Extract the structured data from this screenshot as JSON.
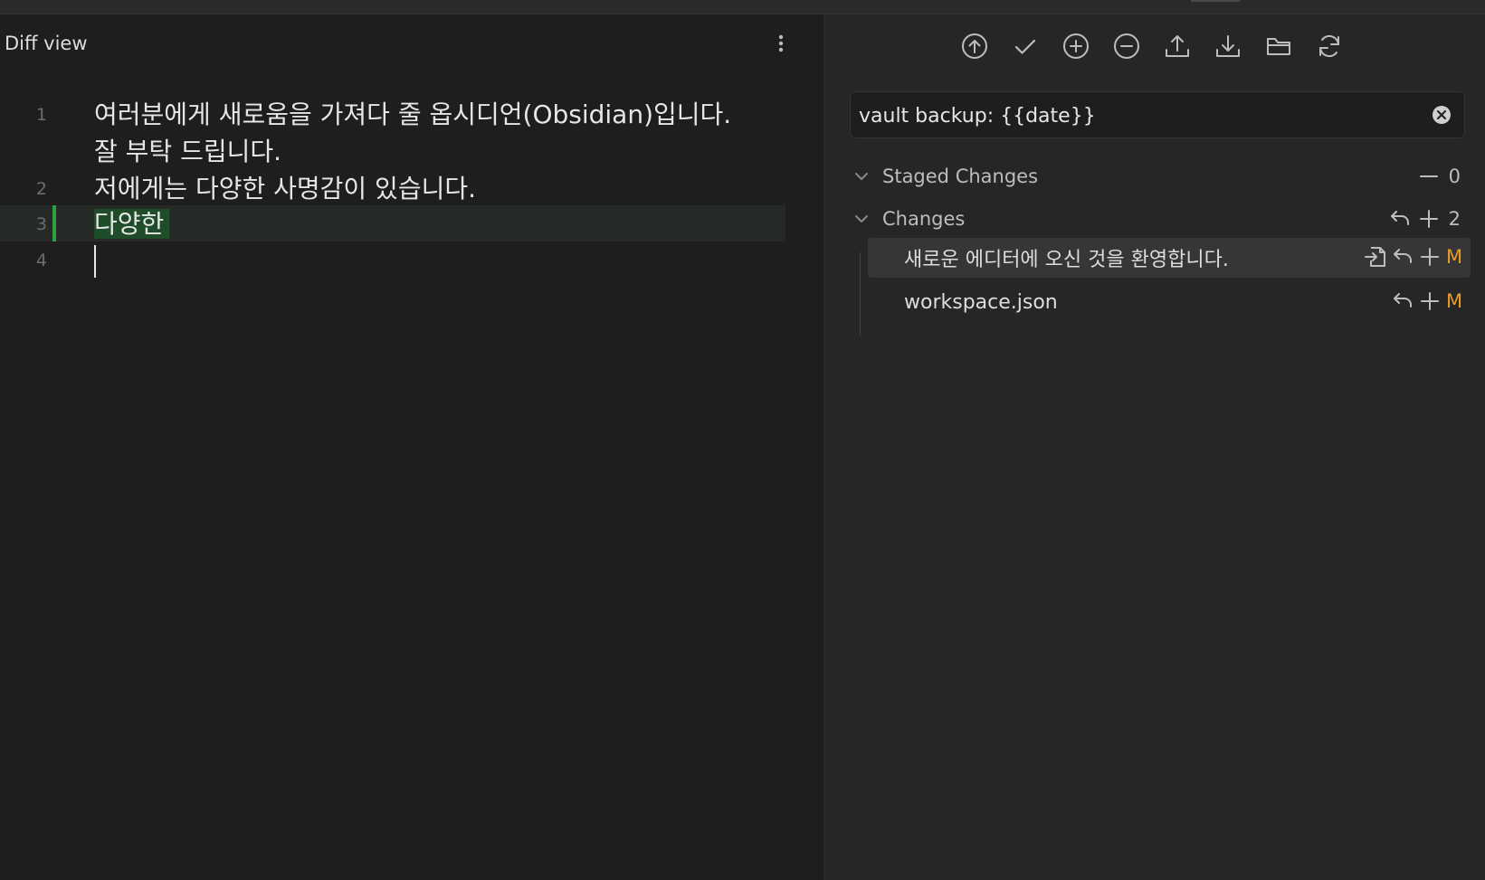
{
  "diff_view": {
    "title": "Diff view",
    "lines": [
      {
        "number": "1",
        "text": "여러분에게 새로움을 가져다 줄 옵시디언(Obsidian)입니다.\n잘 부탁 드립니다."
      },
      {
        "number": "2",
        "text": "저에게는 다양한 사명감이 있습니다."
      },
      {
        "number": "3",
        "text": "다양한",
        "status": "added"
      },
      {
        "number": "4",
        "text": ""
      }
    ]
  },
  "source_control": {
    "toolbar_icons": [
      "push-icon",
      "commit-icon",
      "stage-all-icon",
      "unstage-all-icon",
      "upload-icon",
      "download-icon",
      "open-folder-icon",
      "refresh-icon"
    ],
    "commit_message": "vault backup: {{date}}",
    "staged": {
      "label": "Staged Changes",
      "count": "0"
    },
    "changes": {
      "label": "Changes",
      "count": "2",
      "files": [
        {
          "name": "새로운 에디터에 오신 것을 환영합니다.",
          "status": "M"
        },
        {
          "name": "workspace.json",
          "status": "M"
        }
      ]
    }
  },
  "colors": {
    "added": "#2ea043",
    "modified": "#e89c2a",
    "background": "#1e1e1e",
    "panel": "#262626"
  }
}
